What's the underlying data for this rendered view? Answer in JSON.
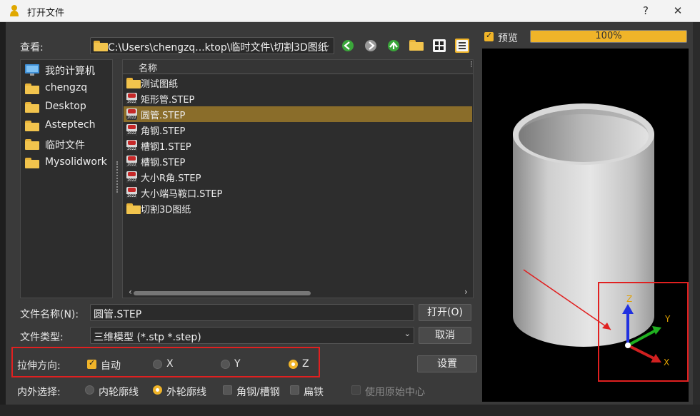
{
  "window": {
    "title": "打开文件",
    "help_label": "?",
    "close_label": "✕"
  },
  "lookin": {
    "label": "查看:",
    "path": "C:\\Users\\chengzq...ktop\\临时文件\\切割3D图纸"
  },
  "sidebar": {
    "items": [
      {
        "label": "我的计算机",
        "icon": "computer-icon"
      },
      {
        "label": "chengzq",
        "icon": "folder-icon"
      },
      {
        "label": "Desktop",
        "icon": "folder-icon"
      },
      {
        "label": "Asteptech",
        "icon": "folder-icon"
      },
      {
        "label": "临时文件",
        "icon": "folder-icon"
      },
      {
        "label": "Mysolidwork",
        "icon": "folder-icon"
      }
    ]
  },
  "filelist": {
    "header": "名称",
    "items": [
      {
        "name": "测试图纸",
        "type": "folder"
      },
      {
        "name": "矩形管.STEP",
        "type": "step"
      },
      {
        "name": "圆管.STEP",
        "type": "step",
        "selected": true
      },
      {
        "name": "角钢.STEP",
        "type": "step"
      },
      {
        "name": "槽钢1.STEP",
        "type": "step"
      },
      {
        "name": "槽钢.STEP",
        "type": "step"
      },
      {
        "name": "大小R角.STEP",
        "type": "step"
      },
      {
        "name": "大小端马鞍口.STEP",
        "type": "step"
      },
      {
        "name": "切割3D图纸",
        "type": "folder"
      }
    ],
    "step_icon_year": "2022"
  },
  "filename": {
    "label": "文件名称(N):",
    "value": "圆管.STEP"
  },
  "filetype": {
    "label": "文件类型:",
    "value": "三维模型 (*.stp *.step)"
  },
  "buttons": {
    "open": "打开(O)",
    "cancel": "取消",
    "settings": "设置"
  },
  "stretch": {
    "label": "拉伸方向:",
    "auto": "自动",
    "auto_checked": true,
    "options": [
      "X",
      "Y",
      "Z"
    ],
    "selected": "Z"
  },
  "inout": {
    "label": "内外选择:",
    "inner": "内轮廓线",
    "outer": "外轮廓线",
    "selected": "外轮廓线",
    "angle": "角钢/槽钢",
    "flat": "扁铁",
    "origin": "使用原始中心"
  },
  "preview": {
    "label": "预览",
    "checked": true,
    "progress_text": "100%",
    "progress_value": 1.0,
    "axis_x": "X",
    "axis_y": "Y",
    "axis_z": "Z"
  },
  "colors": {
    "accent": "#f0b429",
    "selected_row": "#8a6d2a",
    "highlight": "#e02020"
  }
}
